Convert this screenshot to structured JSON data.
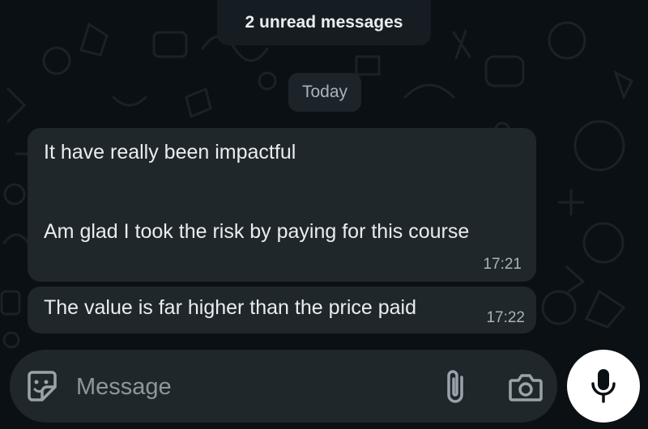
{
  "unread_banner": {
    "text": "2 unread messages"
  },
  "date_divider": {
    "text": "Today"
  },
  "messages": [
    {
      "lines": [
        "It have really been impactful",
        "Am glad I took the risk by paying for this course"
      ],
      "time": "17:21"
    },
    {
      "lines": [
        "The value is far higher than the price paid"
      ],
      "time": "17:22"
    }
  ],
  "composer": {
    "placeholder": "Message",
    "icons": [
      "sticker-icon",
      "attach-icon",
      "camera-icon"
    ]
  },
  "mic_button": {
    "icon": "microphone-icon"
  },
  "colors": {
    "background": "#0b1014",
    "bubble": "#1f272b",
    "text": "#e9edef",
    "meta_text": "#aab3b9",
    "mic_button": "#ffffff"
  }
}
